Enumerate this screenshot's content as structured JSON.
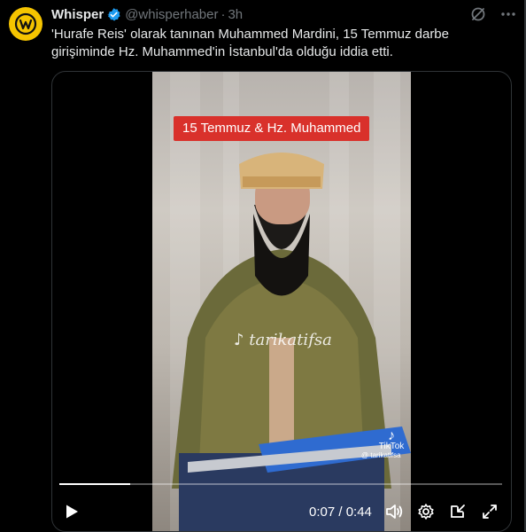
{
  "tweet": {
    "display_name": "Whisper",
    "handle": "@whisperhaber",
    "separator": "·",
    "time": "3h",
    "text": "'Hurafe Reis' olarak tanınan Muhammed Mardini, 15 Temmuz darbe girişiminde Hz. Muhammed'in İstanbul'da olduğu iddia etti.",
    "avatar_icon": "whisper-logo-icon",
    "verified_icon": "verified-badge-icon",
    "colors": {
      "accent": "#1d9bf0",
      "avatar": "#f5c400",
      "banner": "#d9312b"
    }
  },
  "video": {
    "overlay_title": "15 Temmuz & Hz. Muhammed",
    "watermark": "tarikatifsa",
    "tiktok_brand": "TikTok",
    "tiktok_handle": "@ tarikatifsa",
    "progress": 0.16,
    "timecode": "0:07 / 0:44",
    "controls": [
      "play-icon",
      "volume-icon",
      "settings-icon",
      "pip-icon",
      "fullscreen-icon"
    ]
  }
}
